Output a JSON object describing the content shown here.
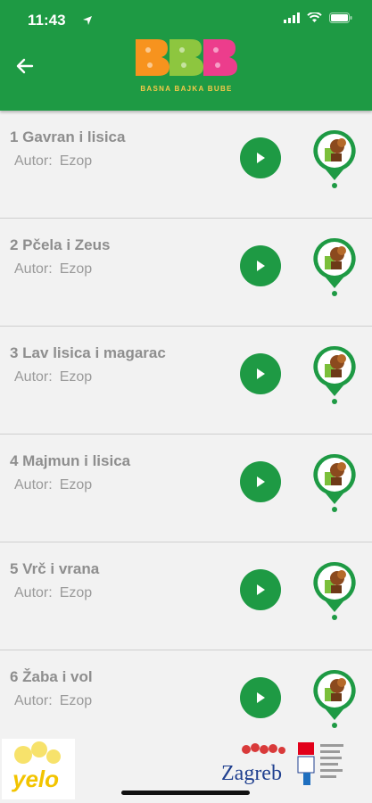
{
  "status_bar": {
    "time": "11:43"
  },
  "header": {
    "logo_text": "BBB",
    "logo_subtitle": "BASNA BAJKA BUBE"
  },
  "stories": [
    {
      "title": "1 Gavran i lisica",
      "author_label": "Autor:",
      "author": "Ezop"
    },
    {
      "title": "2 Pčela i Zeus",
      "author_label": "Autor:",
      "author": "Ezop"
    },
    {
      "title": "3 Lav lisica i magarac",
      "author_label": "Autor:",
      "author": "Ezop"
    },
    {
      "title": "4 Majmun i lisica",
      "author_label": "Autor:",
      "author": "Ezop"
    },
    {
      "title": "5 Vrč i vrana",
      "author_label": "Autor:",
      "author": "Ezop"
    },
    {
      "title": "6 Žaba i vol",
      "author_label": "Autor:",
      "author": "Ezop"
    }
  ],
  "footer": {
    "yelo_text": "yelo",
    "zagreb_text": "Zagreb"
  },
  "colors": {
    "brand_green": "#1e9a44",
    "logo_orange": "#f7931e",
    "logo_green": "#8dc63f",
    "logo_pink": "#ec3d8c"
  }
}
